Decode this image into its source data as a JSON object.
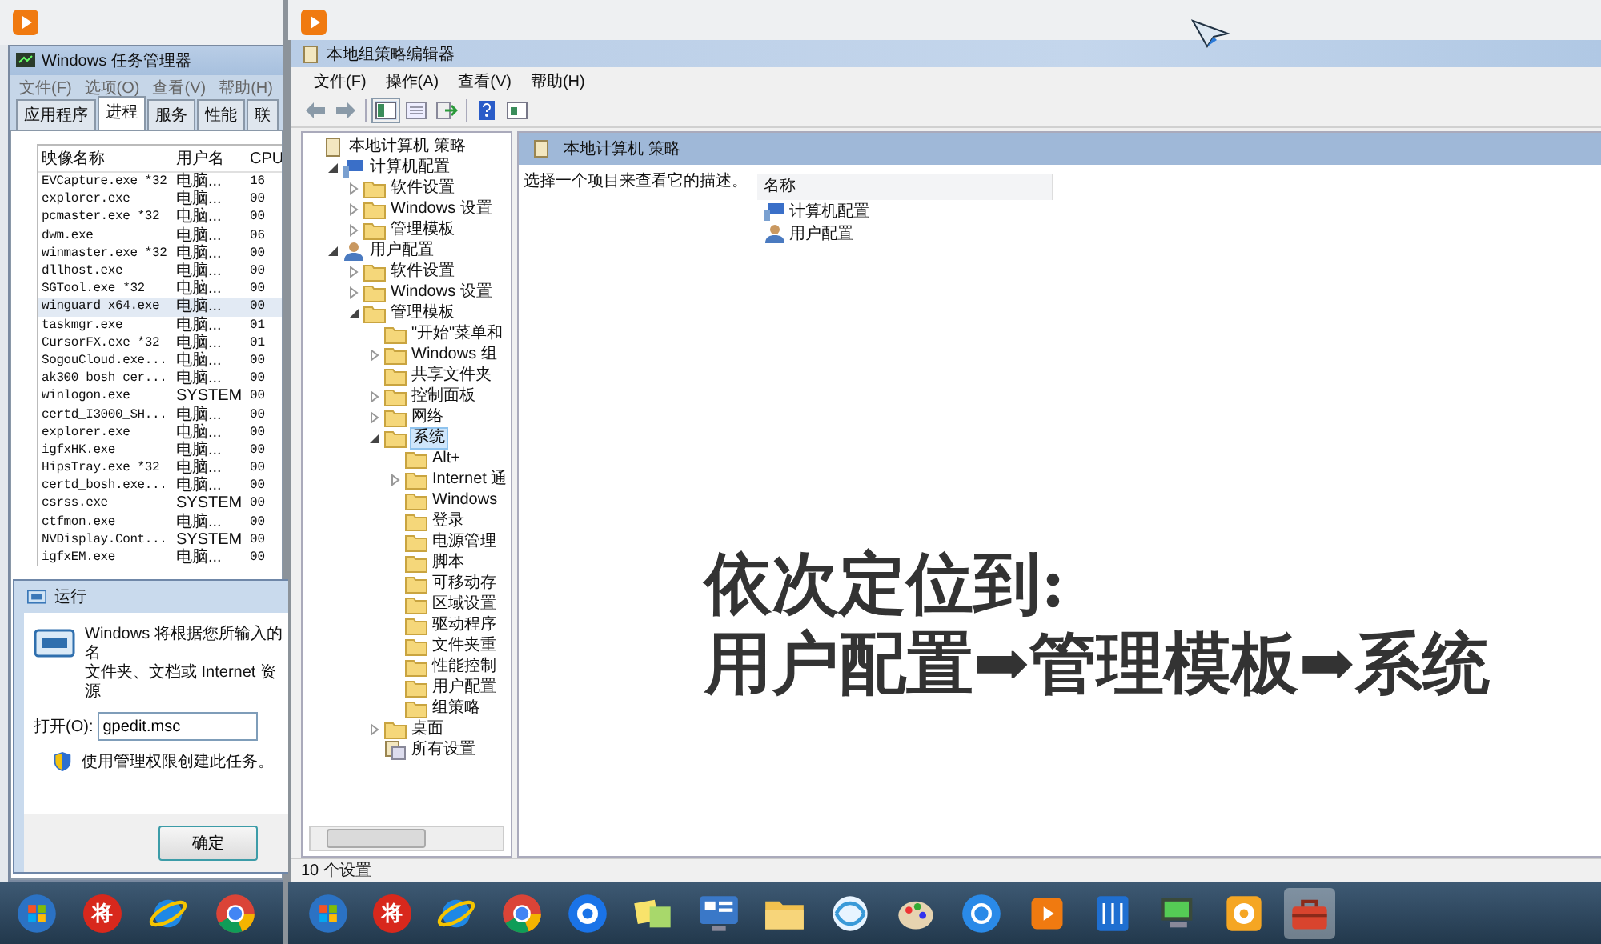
{
  "left_screen": {
    "task_manager": {
      "title": "Windows 任务管理器",
      "menu": [
        "文件(F)",
        "选项(O)",
        "查看(V)",
        "帮助(H)"
      ],
      "tabs": [
        {
          "label": "应用程序",
          "selected": false
        },
        {
          "label": "进程",
          "selected": true
        },
        {
          "label": "服务",
          "selected": false
        },
        {
          "label": "性能",
          "selected": false
        },
        {
          "label": "联",
          "selected": false
        }
      ],
      "columns": [
        "映像名称",
        "用户名",
        "CPU"
      ],
      "rows": [
        {
          "cells": [
            "EVCapture.exe *32",
            "电脑...",
            "16"
          ],
          "selected": false
        },
        {
          "cells": [
            "explorer.exe",
            "电脑...",
            "00"
          ],
          "selected": false
        },
        {
          "cells": [
            "pcmaster.exe *32",
            "电脑...",
            "00"
          ],
          "selected": false
        },
        {
          "cells": [
            "dwm.exe",
            "电脑...",
            "06"
          ],
          "selected": false
        },
        {
          "cells": [
            "winmaster.exe *32",
            "电脑...",
            "00"
          ],
          "selected": false
        },
        {
          "cells": [
            "dllhost.exe",
            "电脑...",
            "00"
          ],
          "selected": false
        },
        {
          "cells": [
            "SGTool.exe *32",
            "电脑...",
            "00"
          ],
          "selected": false
        },
        {
          "cells": [
            "winguard_x64.exe",
            "电脑...",
            "00"
          ],
          "selected": true
        },
        {
          "cells": [
            "taskmgr.exe",
            "电脑...",
            "01"
          ],
          "selected": false
        },
        {
          "cells": [
            "CursorFX.exe *32",
            "电脑...",
            "01"
          ],
          "selected": false
        },
        {
          "cells": [
            "SogouCloud.exe...",
            "电脑...",
            "00"
          ],
          "selected": false
        },
        {
          "cells": [
            "ak300_bosh_cer...",
            "电脑...",
            "00"
          ],
          "selected": false
        },
        {
          "cells": [
            "winlogon.exe",
            "SYSTEM",
            "00"
          ],
          "selected": false
        },
        {
          "cells": [
            "certd_I3000_SH...",
            "电脑...",
            "00"
          ],
          "selected": false
        },
        {
          "cells": [
            "explorer.exe",
            "电脑...",
            "00"
          ],
          "selected": false
        },
        {
          "cells": [
            "igfxHK.exe",
            "电脑...",
            "00"
          ],
          "selected": false
        },
        {
          "cells": [
            "HipsTray.exe *32",
            "电脑...",
            "00"
          ],
          "selected": false
        },
        {
          "cells": [
            "certd_bosh.exe...",
            "电脑...",
            "00"
          ],
          "selected": false
        },
        {
          "cells": [
            "csrss.exe",
            "SYSTEM",
            "00"
          ],
          "selected": false
        },
        {
          "cells": [
            "ctfmon.exe",
            "电脑...",
            "00"
          ],
          "selected": false
        },
        {
          "cells": [
            "NVDisplay.Cont...",
            "SYSTEM",
            "00"
          ],
          "selected": false
        },
        {
          "cells": [
            "igfxEM.exe",
            "电脑...",
            "00"
          ],
          "selected": false
        }
      ]
    },
    "run_dialog": {
      "title": "运行",
      "description": [
        "Windows 将根据您所输入的名",
        "文件夹、文档或 Internet 资源"
      ],
      "open_label": "打开(O):",
      "value": "gpedit.msc",
      "admin_note": "使用管理权限创建此任务。",
      "ok_button": "确定"
    },
    "taskbar": {
      "badge": "将"
    }
  },
  "right_screen": {
    "window": {
      "title": "本地组策略编辑器"
    },
    "menu": [
      "文件(F)",
      "操作(A)",
      "查看(V)",
      "帮助(H)"
    ],
    "tree": [
      {
        "label": "本地计算机 策略",
        "kind": "policy",
        "selected": false,
        "children": [
          {
            "label": "计算机配置",
            "kind": "computer",
            "expanded": true,
            "selected": false,
            "children": [
              {
                "label": "软件设置",
                "kind": "folder",
                "expanded": false,
                "selected": false
              },
              {
                "label": "Windows 设置",
                "kind": "folder",
                "expanded": false,
                "selected": false
              },
              {
                "label": "管理模板",
                "kind": "folder",
                "expanded": false,
                "selected": false
              }
            ]
          },
          {
            "label": "用户配置",
            "kind": "user",
            "expanded": true,
            "selected": false,
            "children": [
              {
                "label": "软件设置",
                "kind": "folder",
                "expanded": false,
                "selected": false
              },
              {
                "label": "Windows 设置",
                "kind": "folder",
                "expanded": false,
                "selected": false
              },
              {
                "label": "管理模板",
                "kind": "folder",
                "expanded": true,
                "selected": false,
                "children": [
                  {
                    "label": "\"开始\"菜单和",
                    "kind": "folder",
                    "selected": false
                  },
                  {
                    "label": "Windows 组",
                    "kind": "folder",
                    "expanded": false,
                    "selected": false
                  },
                  {
                    "label": "共享文件夹",
                    "kind": "folder",
                    "selected": false
                  },
                  {
                    "label": "控制面板",
                    "kind": "folder",
                    "expanded": false,
                    "selected": false
                  },
                  {
                    "label": "网络",
                    "kind": "folder",
                    "expanded": false,
                    "selected": false
                  },
                  {
                    "label": "系统",
                    "kind": "folder",
                    "expanded": true,
                    "selected": true,
                    "children": [
                      {
                        "label": "Alt+",
                        "kind": "folder",
                        "selected": false
                      },
                      {
                        "label": "Internet 通",
                        "kind": "folder",
                        "expanded": false,
                        "selected": false
                      },
                      {
                        "label": "Windows",
                        "kind": "folder",
                        "selected": false
                      },
                      {
                        "label": "登录",
                        "kind": "folder",
                        "selected": false
                      },
                      {
                        "label": "电源管理",
                        "kind": "folder",
                        "selected": false
                      },
                      {
                        "label": "脚本",
                        "kind": "folder",
                        "selected": false
                      },
                      {
                        "label": "可移动存",
                        "kind": "folder",
                        "selected": false
                      },
                      {
                        "label": "区域设置",
                        "kind": "folder",
                        "selected": false
                      },
                      {
                        "label": "驱动程序",
                        "kind": "folder",
                        "selected": false
                      },
                      {
                        "label": "文件夹重",
                        "kind": "folder",
                        "selected": false
                      },
                      {
                        "label": "性能控制",
                        "kind": "folder",
                        "selected": false
                      },
                      {
                        "label": "用户配置",
                        "kind": "folder",
                        "selected": false
                      },
                      {
                        "label": "组策略",
                        "kind": "folder",
                        "selected": false
                      }
                    ]
                  },
                  {
                    "label": "桌面",
                    "kind": "folder",
                    "expanded": false,
                    "selected": false
                  },
                  {
                    "label": "所有设置",
                    "kind": "settings",
                    "selected": false
                  }
                ]
              }
            ]
          }
        ]
      }
    ],
    "content": {
      "header": "本地计算机 策略",
      "description": "选择一个项目来查看它的描述。",
      "column": "名称",
      "items": [
        {
          "label": "计算机配置",
          "kind": "computer"
        },
        {
          "label": "用户配置",
          "kind": "user"
        }
      ]
    },
    "status_bar": "10 个设置",
    "taskbar": {
      "badge": "将"
    }
  },
  "caption": [
    "依次定位到:",
    "用户配置➡管理模板➡系统"
  ]
}
